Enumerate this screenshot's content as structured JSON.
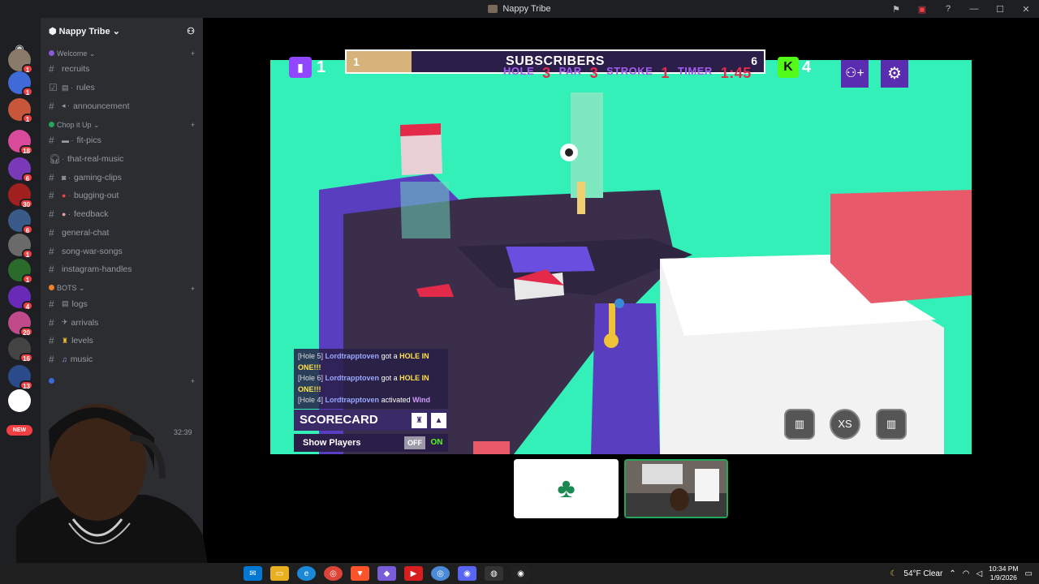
{
  "window": {
    "title": "Nappy Tribe"
  },
  "server_badges": [
    "1",
    "1",
    "1",
    "18",
    "6",
    "30",
    "6",
    "1",
    "1",
    "4",
    "20",
    "16",
    "13"
  ],
  "new_label": "NEW",
  "guild": {
    "name": "Nappy Tribe"
  },
  "categories": {
    "welcome": "Welcome",
    "chop": "Chop it Up",
    "bots": "BOTS"
  },
  "channels": {
    "recruits": "recruits",
    "rules": "rules",
    "announcement": "announcement",
    "fit_pics": "fit-pics",
    "that_real_music": "that-real-music",
    "gaming_clips": "gaming-clips",
    "bugging_out": "bugging-out",
    "feedback": "feedback",
    "general_chat": "general-chat",
    "song_war_songs": "song-war-songs",
    "instagram_handles": "instagram-handles",
    "logs": "logs",
    "arrivals": "arrivals",
    "levels": "levels",
    "music": "music"
  },
  "voice_timer": "32:39",
  "game": {
    "twitch_count": "1",
    "kick_count": "4",
    "subscribers_left": "1",
    "subscribers_title": "SUBSCRIBERS",
    "subscribers_right": "6",
    "hole_label": "HOLE",
    "hole_value": "3",
    "par_label": "PAR",
    "par_value": "3",
    "stroke_label": "STROKE",
    "stroke_value": "1",
    "timer_label": "TIMER",
    "timer_value": "1:45",
    "chat": [
      {
        "hole": "[Hole 5]",
        "user": "Lordtrapptoven",
        "text": "got a",
        "hl": "HOLE IN ONE!!!"
      },
      {
        "hole": "[Hole 6]",
        "user": "Lordtrapptoven",
        "text": "got a",
        "hl": "HOLE IN ONE!!!"
      },
      {
        "hole": "[Hole 4]",
        "user": "Lordtrapptoven",
        "text": "activated",
        "hl": "Wind"
      }
    ],
    "scorecard_label": "SCORECARD",
    "show_players_label": "Show Players",
    "toggle_off": "OFF",
    "toggle_on": "ON",
    "xs_label": "XS"
  },
  "taskbar": {
    "weather": "54°F  Clear",
    "time": "10:34 PM",
    "date": "1/9/2026"
  },
  "colors": {
    "discord_bg": "#2b2d31",
    "game_bg": "#33f0b8",
    "hud_purple": "#2b1f4a",
    "accent_red": "#e32a4a"
  }
}
